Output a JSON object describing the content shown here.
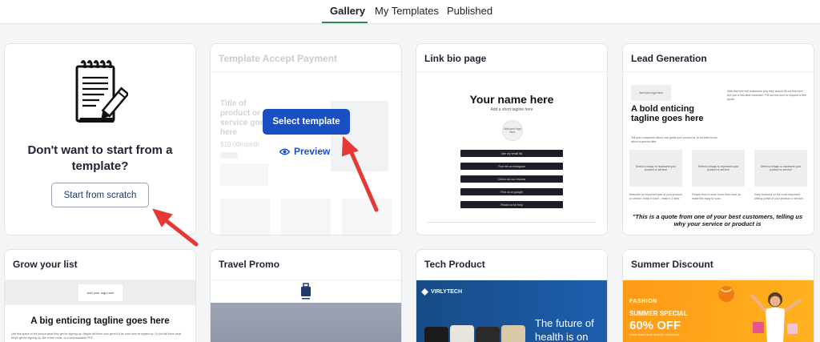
{
  "tabs": [
    {
      "label": "Gallery",
      "active": true
    },
    {
      "label": "My Templates",
      "active": false
    },
    {
      "label": "Published",
      "active": false
    }
  ],
  "colors": {
    "accent": "#1a4fc4",
    "tab_underline": "#2e8b57",
    "arrow": "#e53935"
  },
  "scratch": {
    "heading": "Don't want to start from a template?",
    "button": "Start from scratch",
    "icon": "notepad-pencil-icon"
  },
  "cards": {
    "payment": {
      "title": "Template Accept Payment",
      "product_title": "Title of product or service goes here",
      "price": "$10.00/month",
      "select_button": "Select template",
      "preview_link": "Preview"
    },
    "link_bio": {
      "title": "Link bio page",
      "heading": "Your name here",
      "subtitle": "Add a short tagline here",
      "logo": "Add your logo here",
      "links": [
        "Join my email list",
        "Find me on Instagram",
        "Check out our reviews",
        "Find us on google",
        "Reach us for help"
      ]
    },
    "lead_gen": {
      "title": "Lead Generation",
      "logo": "Add your logo here",
      "tagline": "A bold enticing tagline goes here",
      "side_text": "With this form tell customers why they should fill out this form. Are you a first-time customer? Fill out this form to request a free quote.",
      "desc": "Tell your customers about how great your product is, to let them know about a special offer.",
      "box_text": "Select a image to represent your product or service",
      "benefits": [
        "Describe an important part of your product or service. Keep it short - make it 3 lines.",
        "People tend to scan more than read, so make this easy to scan.",
        "Keep featured on the most important selling points of your product or service."
      ],
      "quote": "\"This is a quote from one of your best customers, telling us why your service or product is"
    },
    "grow": {
      "title": "Grow your list",
      "logo": "Add your logo here",
      "tagline": "A big enticing tagline goes here",
      "text": "Use this space to tell people what they get for signing up. Maybe tell them how great it'd be once they've signed up. Or just tell them what they'll get for signing up, like a free t-shirt, or a downloadable PDF."
    },
    "travel": {
      "title": "Travel Promo"
    },
    "tech": {
      "title": "Tech Product",
      "brand": "VIRLYTECH",
      "headline": "The future of health is on your"
    },
    "summer": {
      "title": "Summer Discount",
      "brand": "FASHION",
      "special": "SUMMER SPECIAL",
      "offer": "60% OFF",
      "small": "Lorem ipsum dolor sit amet, consectetur"
    }
  }
}
